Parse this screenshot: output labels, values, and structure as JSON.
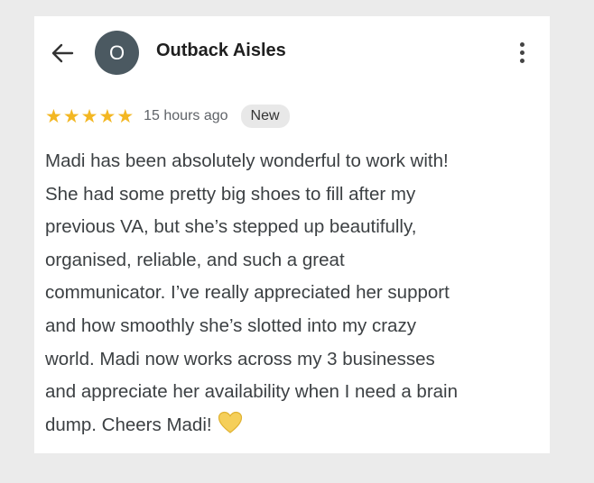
{
  "header": {
    "avatar_initial": "O",
    "business_name": "Outback Aisles"
  },
  "review": {
    "rating": 5,
    "rating_max": 5,
    "time": "15 hours ago",
    "badge": "New",
    "lines": [
      "Madi has been absolutely wonderful to work with!",
      "She had some pretty big shoes to fill after my",
      "previous VA, but she’s stepped up beautifully,",
      "organised, reliable, and such a great",
      "communicator. I’ve really appreciated her support",
      "and how smoothly she’s slotted into my crazy",
      "world. Madi now works across my 3 businesses",
      "and appreciate her availability when I need a brain",
      "dump. Cheers Madi!"
    ]
  },
  "colors": {
    "star": "#f3b723",
    "avatar_bg": "#4b5961",
    "heart": "#f5cf5a",
    "background": "#ebebeb"
  },
  "icons": {
    "back": "arrow-left-icon",
    "more": "more-vertical-icon",
    "emoji": "yellow-heart-icon"
  }
}
